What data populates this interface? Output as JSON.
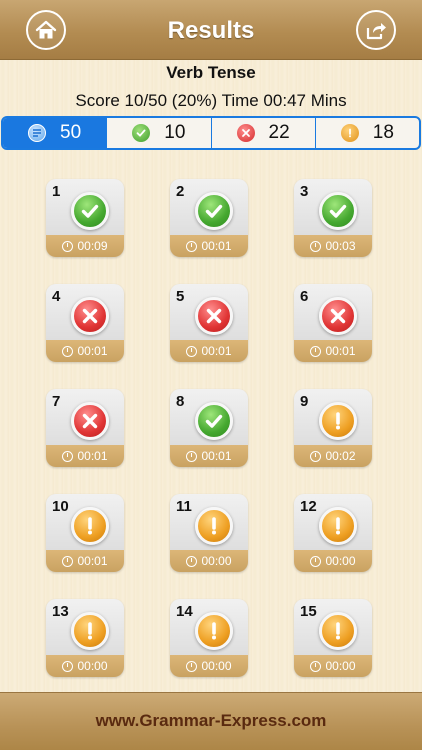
{
  "header": {
    "title": "Results",
    "home_icon": "home-icon",
    "share_icon": "share-icon"
  },
  "quiz": {
    "name": "Verb Tense",
    "score_line": "Score 10/50  (20%) Time 00:47 Mins"
  },
  "filters": [
    {
      "key": "total",
      "icon": "list-icon",
      "count": "50",
      "active": true
    },
    {
      "key": "correct",
      "icon": "check-icon",
      "count": "10",
      "active": false
    },
    {
      "key": "wrong",
      "icon": "cross-icon",
      "count": "22",
      "active": false
    },
    {
      "key": "skipped",
      "icon": "exclamation-icon",
      "count": "18",
      "active": false
    }
  ],
  "questions": [
    {
      "num": "1",
      "status": "correct",
      "time": "00:09"
    },
    {
      "num": "2",
      "status": "correct",
      "time": "00:01"
    },
    {
      "num": "3",
      "status": "correct",
      "time": "00:03"
    },
    {
      "num": "4",
      "status": "wrong",
      "time": "00:01"
    },
    {
      "num": "5",
      "status": "wrong",
      "time": "00:01"
    },
    {
      "num": "6",
      "status": "wrong",
      "time": "00:01"
    },
    {
      "num": "7",
      "status": "wrong",
      "time": "00:01"
    },
    {
      "num": "8",
      "status": "correct",
      "time": "00:01"
    },
    {
      "num": "9",
      "status": "skipped",
      "time": "00:02"
    },
    {
      "num": "10",
      "status": "skipped",
      "time": "00:01"
    },
    {
      "num": "11",
      "status": "skipped",
      "time": "00:00"
    },
    {
      "num": "12",
      "status": "skipped",
      "time": "00:00"
    },
    {
      "num": "13",
      "status": "skipped",
      "time": "00:00"
    },
    {
      "num": "14",
      "status": "skipped",
      "time": "00:00"
    },
    {
      "num": "15",
      "status": "skipped",
      "time": "00:00"
    }
  ],
  "colors": {
    "accent": "#1a78e0",
    "correct": "#45a830",
    "wrong": "#e03434",
    "skipped": "#ee9f22",
    "wood": "#b89257"
  },
  "footer": {
    "site": "www.Grammar-Express.com"
  }
}
